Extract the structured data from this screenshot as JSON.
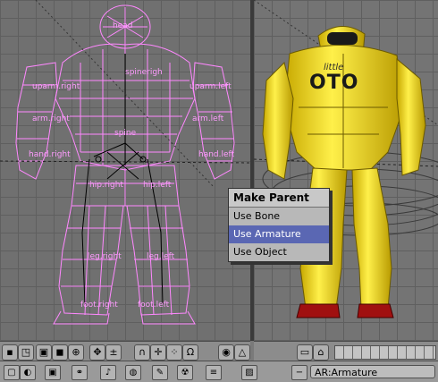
{
  "bones": {
    "head": "head",
    "spine_right": "spinerigh",
    "uparm_right": "uparm.right",
    "uparm_left": "uparm.left",
    "arm_right": "arm.right",
    "arm_left": "arm.left",
    "spine": "spine",
    "hand_right": "hand.right",
    "hand_left": "hand.left",
    "hip_right": "hip.right",
    "hip_left": "hip.left",
    "leg_right": "leg.right",
    "leg_left": "leg.left",
    "foot_right": "foot.right",
    "foot_left": "foot.left"
  },
  "chest_text": {
    "line1": "little",
    "line2": "OTO"
  },
  "menu": {
    "title": "Make Parent",
    "items": [
      "Use Bone",
      "Use Armature",
      "Use Object"
    ],
    "selected": "Use Armature"
  },
  "status": {
    "object_name": "AR:Armature"
  },
  "colors": {
    "wire": "#ff88ff",
    "body": "#f2e600",
    "menu_highlight": "#5a67b3"
  }
}
